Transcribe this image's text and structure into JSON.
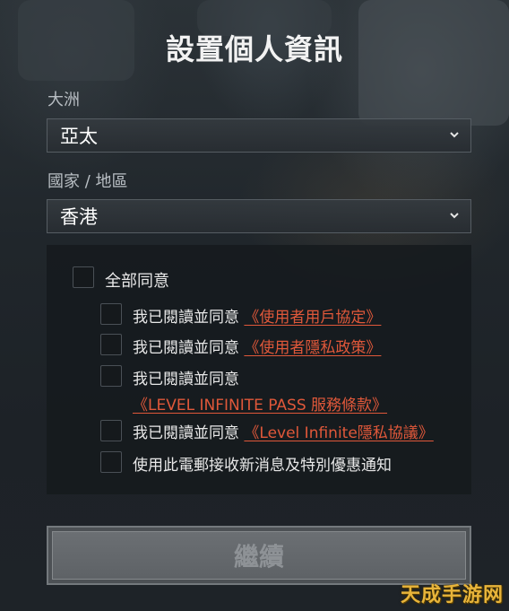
{
  "header": {
    "title": "設置個人資訊"
  },
  "form": {
    "continent": {
      "label": "大洲",
      "value": "亞太"
    },
    "region": {
      "label": "國家 / 地區",
      "value": "香港"
    }
  },
  "agreements": {
    "all": "全部同意",
    "items": [
      {
        "prefix": "我已閱讀並同意",
        "link": "《使用者用戶協定》"
      },
      {
        "prefix": "我已閱讀並同意",
        "link": "《使用者隱私政策》"
      },
      {
        "prefix": "我已閱讀並同意",
        "link": "《LEVEL INFINITE PASS 服務條款》"
      },
      {
        "prefix": "我已閱讀並同意",
        "link": "《Level Infinite隱私協議》"
      }
    ],
    "email_opt_in": "使用此電郵接收新消息及特別優惠通知"
  },
  "actions": {
    "continue_label": "繼續"
  },
  "watermark": "天成手游网",
  "colors": {
    "link": "#e0583a",
    "button_disabled": "#5e6266",
    "watermark": "#e8b43a"
  }
}
